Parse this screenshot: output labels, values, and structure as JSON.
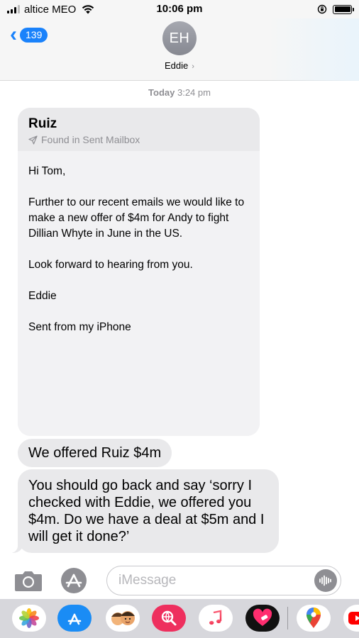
{
  "status_bar": {
    "carrier": "altice MEO",
    "time": "10:06 pm"
  },
  "header": {
    "back_count": "139",
    "avatar_initials": "EH",
    "contact_name": "Eddie"
  },
  "timestamp": {
    "day": "Today",
    "time": "3:24 pm"
  },
  "email": {
    "sender": "Ruiz",
    "found_in": "Found in Sent Mailbox",
    "paragraphs": [
      "Hi Tom,",
      "Further to our recent emails we would like to make a new offer of $4m for Andy to fight Dillian Whyte in June in the US.",
      "Look forward to hearing from you.",
      "Eddie",
      "Sent from my iPhone"
    ]
  },
  "messages": [
    "We offered Ruiz $4m",
    "You should go back and say ‘sorry I checked with Eddie, we offered you $4m. Do we have a deal at $5m and I will get it done?’"
  ],
  "input": {
    "placeholder": "iMessage"
  },
  "app_drawer": {
    "apps": [
      "photos-icon",
      "app-store-icon",
      "memoji-icon",
      "web-search-icon",
      "music-icon",
      "heart-app-icon",
      "maps-icon",
      "youtube-icon"
    ]
  },
  "colors": {
    "accent": "#1a82fb",
    "bubble_gray": "#e9e9eb",
    "header_bg": "#f6f6f6",
    "drawer_bg": "#d7d7dc"
  }
}
